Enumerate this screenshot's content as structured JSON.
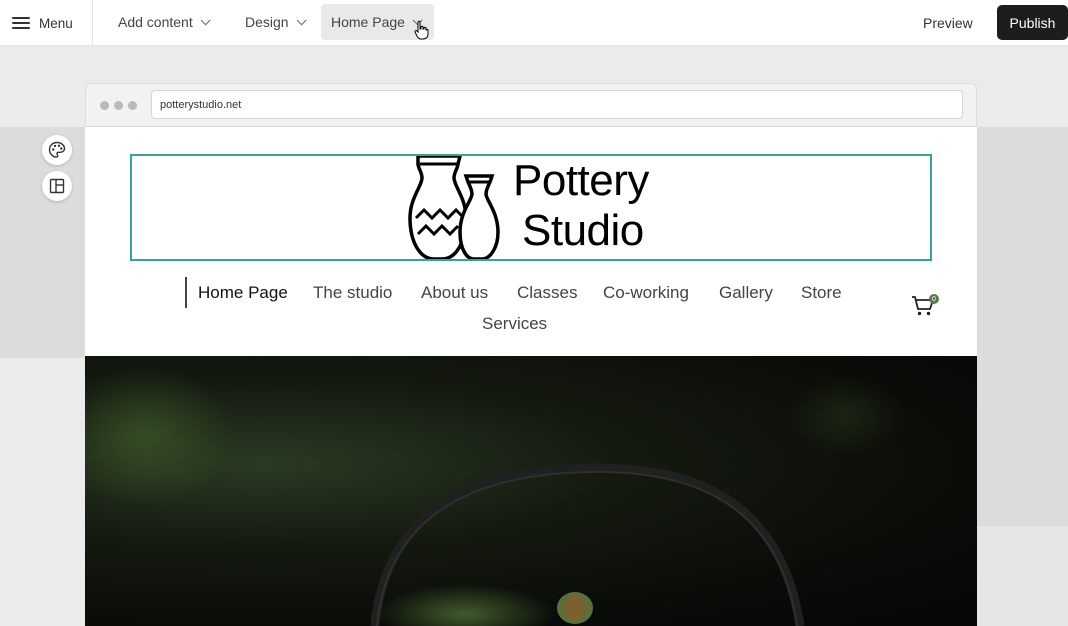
{
  "topbar": {
    "menu_label": "Menu",
    "add_content_label": "Add content",
    "design_label": "Design",
    "page_selector_label": "Home Page",
    "preview_label": "Preview",
    "publish_label": "Publish"
  },
  "browser": {
    "url": "potterystudio.net"
  },
  "site": {
    "logo_line1": "Pottery",
    "logo_line2": "Studio",
    "nav": {
      "items": [
        "Home Page",
        "The studio",
        "About us",
        "Classes",
        "Co-working",
        "Gallery",
        "Store",
        "Services"
      ],
      "current": "Home Page"
    },
    "cart_count": "0"
  },
  "colors": {
    "accent_selection": "#35a496",
    "publish_bg": "#1d1d1d",
    "cart_badge": "#5a7a55"
  }
}
